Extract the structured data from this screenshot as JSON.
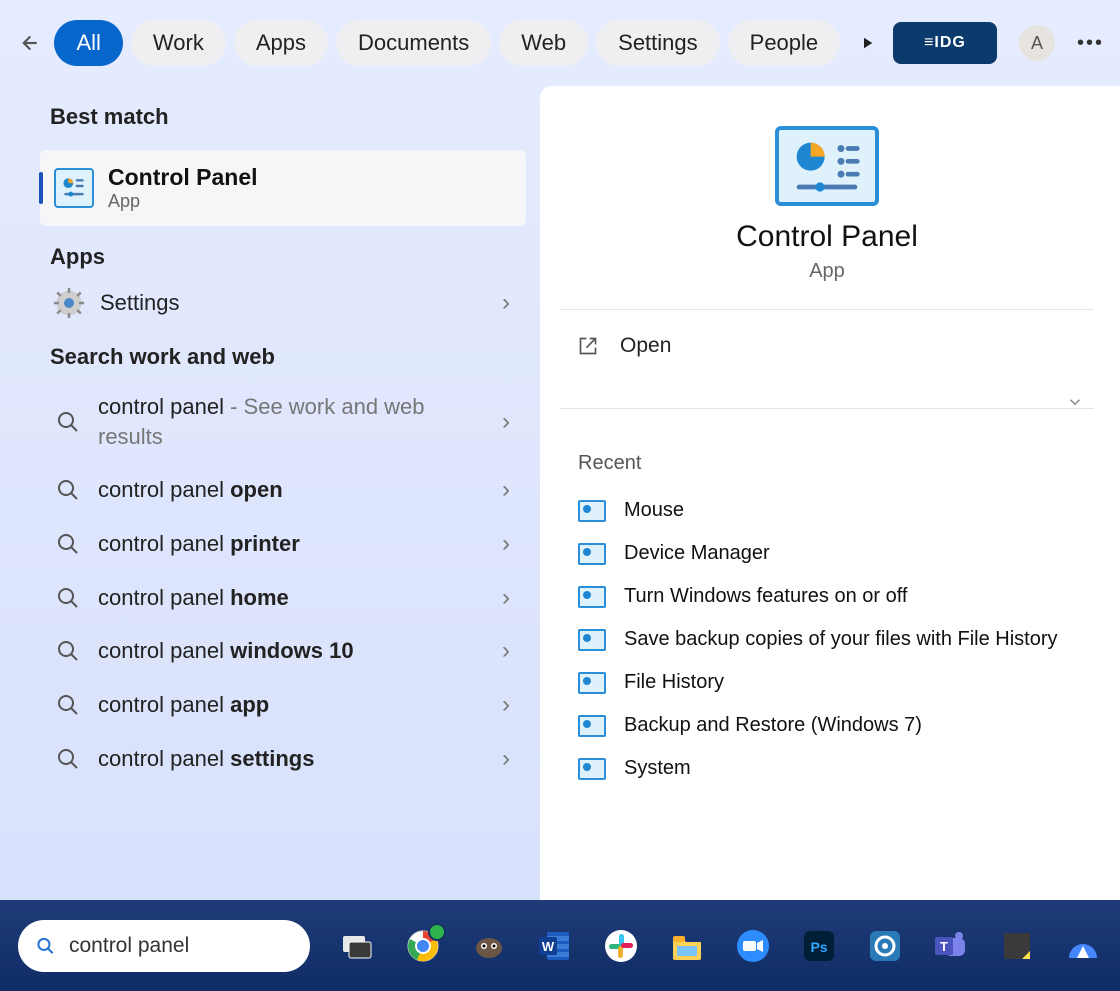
{
  "tabs": {
    "items": [
      {
        "label": "All",
        "active": true
      },
      {
        "label": "Work"
      },
      {
        "label": "Apps"
      },
      {
        "label": "Documents"
      },
      {
        "label": "Web"
      },
      {
        "label": "Settings"
      },
      {
        "label": "People"
      }
    ]
  },
  "top_right": {
    "org_label": "≡IDG",
    "avatar_initial": "A"
  },
  "left": {
    "best_match_header": "Best match",
    "best_match": {
      "title": "Control Panel",
      "subtitle": "App"
    },
    "apps_header": "Apps",
    "apps_item": "Settings",
    "search_header": "Search work and web",
    "search_items": [
      {
        "prefix": "control panel",
        "suffix": "",
        "trail": " - See work and web results"
      },
      {
        "prefix": "control panel ",
        "suffix": "open",
        "trail": ""
      },
      {
        "prefix": "control panel ",
        "suffix": "printer",
        "trail": ""
      },
      {
        "prefix": "control panel ",
        "suffix": "home",
        "trail": ""
      },
      {
        "prefix": "control panel ",
        "suffix": "windows 10",
        "trail": ""
      },
      {
        "prefix": "control panel ",
        "suffix": "app",
        "trail": ""
      },
      {
        "prefix": "control panel ",
        "suffix": "settings",
        "trail": ""
      }
    ]
  },
  "right": {
    "title": "Control Panel",
    "subtitle": "App",
    "open_label": "Open",
    "recent_header": "Recent",
    "recent": [
      "Mouse",
      "Device Manager",
      "Turn Windows features on or off",
      "Save backup copies of your files with File History",
      "File History",
      "Backup and Restore (Windows 7)",
      "System"
    ]
  },
  "taskbar": {
    "search_value": "control panel",
    "apps": [
      "task-view",
      "chrome",
      "gimp",
      "word",
      "slack",
      "file-explorer",
      "zoom",
      "photoshop",
      "snagit",
      "teams",
      "sticky-notes",
      "nordvpn"
    ]
  }
}
